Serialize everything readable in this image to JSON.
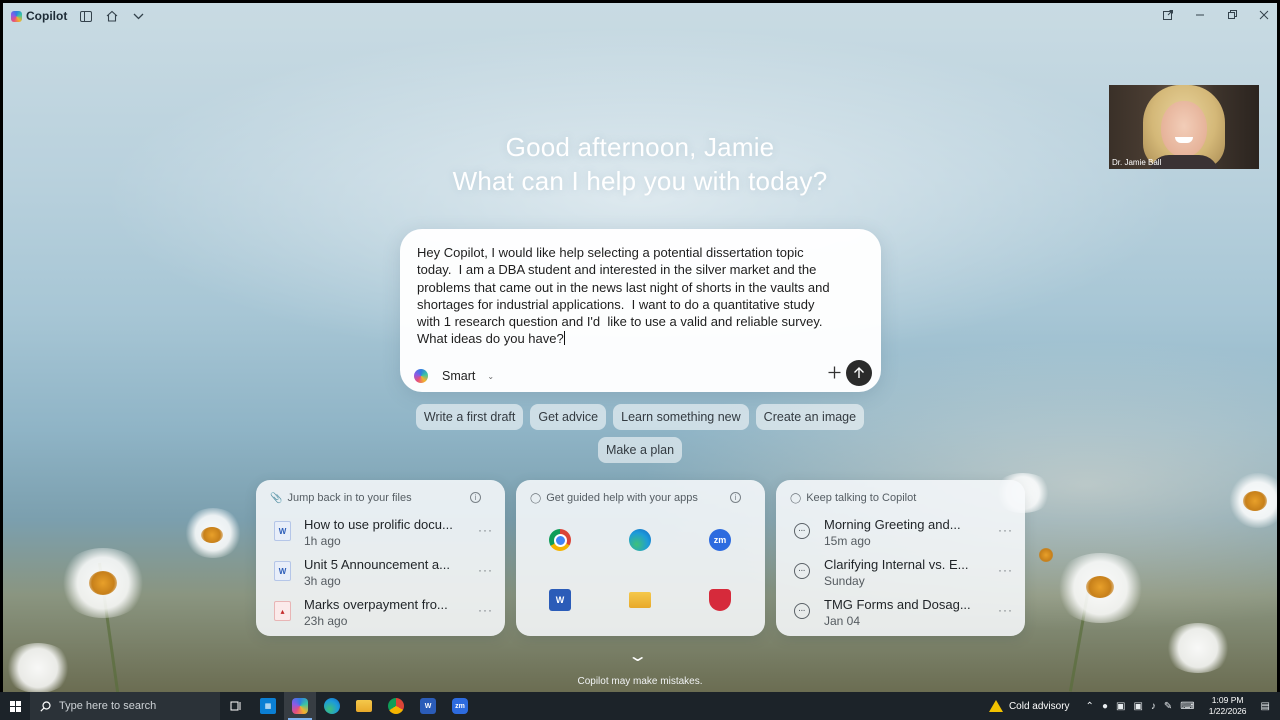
{
  "window": {
    "app_name": "Copilot",
    "title_icons": [
      "sidebar-icon",
      "home-icon",
      "chevron-down-icon"
    ],
    "controls": [
      "new-window-icon",
      "minimize-icon",
      "restore-icon",
      "close-icon"
    ]
  },
  "greeting": {
    "line1": "Good afternoon, Jamie",
    "line2": "What can I help you with today?"
  },
  "webcam": {
    "name": "Dr. Jamie Ball"
  },
  "prompt": {
    "text": "Hey Copilot, I would like help selecting a potential dissertation topic\ntoday.  I am a DBA student and interested in the silver market and the\nproblems that came out in the news last night of shorts in the vaults and\nshortages for industrial applications.  I want to do a quantitative study\nwith 1 research question and I'd  like to use a valid and reliable survey.\nWhat ideas do you have?",
    "mode": "Smart"
  },
  "chips": {
    "row1": [
      "Write a first draft",
      "Get advice",
      "Learn something new",
      "Create an image"
    ],
    "row2": [
      "Make a plan"
    ]
  },
  "cards": {
    "files": {
      "title": "Jump back in to your files",
      "items": [
        {
          "title": "How to use prolific docu...",
          "time": "1h ago",
          "type": "word"
        },
        {
          "title": "Unit 5 Announcement a...",
          "time": "3h ago",
          "type": "word"
        },
        {
          "title": "Marks overpayment fro...",
          "time": "23h ago",
          "type": "pdf"
        }
      ]
    },
    "apps": {
      "title": "Get guided help with your apps",
      "items": [
        "chrome-icon",
        "edge-icon",
        "zoom-icon",
        "word-icon",
        "file-explorer-icon",
        "shield-icon"
      ],
      "zoom_label": "zm",
      "word_label": "W"
    },
    "chats": {
      "title": "Keep talking to Copilot",
      "items": [
        {
          "title": "Morning Greeting and...",
          "time": "15m ago"
        },
        {
          "title": "Clarifying Internal vs. E...",
          "time": "Sunday"
        },
        {
          "title": "TMG Forms and Dosag...",
          "time": "Jan 04"
        }
      ]
    }
  },
  "disclaimer": "Copilot may make mistakes.",
  "taskbar": {
    "search_placeholder": "Type here to search",
    "weather": "Cold advisory",
    "time": "1:09 PM",
    "date": "1/22/2026",
    "zoom_label": "zm",
    "word_label": "W"
  },
  "colors": {
    "send_button": "#2b2b2b",
    "taskbar": "#1c2329",
    "warning": "#f2c200"
  }
}
